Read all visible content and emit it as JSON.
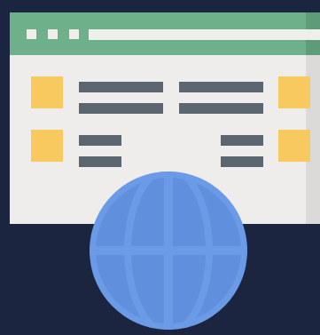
{
  "illustration": {
    "subject": "web-browser-with-globe",
    "icons": [
      "browser-window-icon",
      "globe-icon"
    ]
  },
  "colors": {
    "background": "#1b2540",
    "page": "#efedec",
    "page_shade": "#dcdad9",
    "titlebar": "#6db08a",
    "titlebar_shade": "#5e9c79",
    "titlebar_light": "#eeeeea",
    "tile_yellow": "#f7c95e",
    "line_slate": "#5b6670",
    "globe_fill": "#5f8fdd",
    "globe_lines": "#6b9ae6"
  }
}
